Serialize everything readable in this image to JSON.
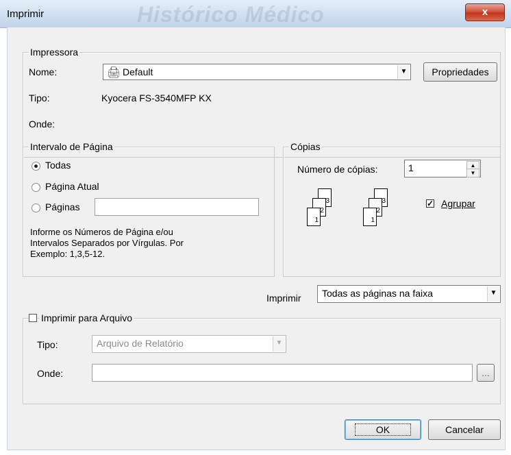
{
  "window": {
    "title": "Imprimir",
    "watermark": "Histórico Médico",
    "close_label": "x"
  },
  "printer": {
    "group_label": "Impressora",
    "name_label": "Nome:",
    "name_value": "Default",
    "properties_button": "Propriedades",
    "type_label": "Tipo:",
    "type_value": "Kyocera FS-3540MFP KX",
    "where_label": "Onde:"
  },
  "range": {
    "group_label": "Intervalo de Página",
    "all_label": "Todas",
    "current_label": "Página Atual",
    "pages_label": "Páginas",
    "pages_value": "",
    "selected": "all",
    "help_line1": "Informe os Números de Página e/ou",
    "help_line2": "Intervalos Separados por Vírgulas. Por",
    "help_line3": "Exemplo: 1,3,5-12."
  },
  "copies": {
    "group_label": "Cópias",
    "count_label": "Número de cópias:",
    "count_value": "1",
    "collate_label": "Agrupar",
    "collate_checked": true,
    "page_numbers": [
      "1",
      "2",
      "3"
    ]
  },
  "print_select": {
    "label": "Imprimir",
    "value": "Todas as páginas na faixa"
  },
  "file": {
    "checkbox_label": "Imprimir para Arquivo",
    "checked": false,
    "type_label": "Tipo:",
    "type_value": "Arquivo de Relatório",
    "where_label": "Onde:",
    "where_value": "",
    "browse_label": "..."
  },
  "buttons": {
    "ok": "OK",
    "cancel": "Cancelar"
  }
}
